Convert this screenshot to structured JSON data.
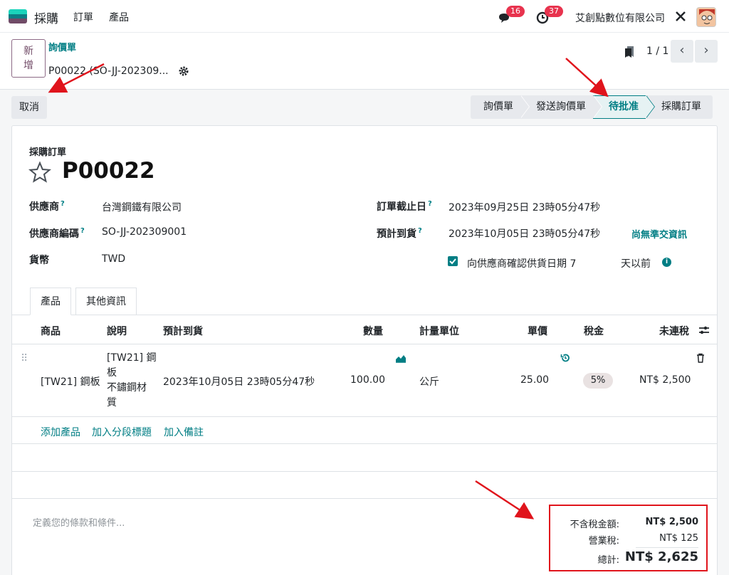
{
  "nav": {
    "app_name": "採購",
    "menu": [
      "訂單",
      "產品"
    ],
    "messages_count": "16",
    "activities_count": "37",
    "company": "艾創點數位有限公司"
  },
  "control": {
    "new_label": "新增",
    "breadcrumb": "詢價單",
    "record_name": "P00022 (SO-JJ-202309...",
    "pager": "1 / 1"
  },
  "actions": {
    "cancel_label": "取消",
    "stages": [
      "詢價單",
      "發送詢價單",
      "待批准",
      "採購訂單"
    ],
    "active_stage": "待批准"
  },
  "form": {
    "doc_type": "採購訂單",
    "title": "P00022",
    "vendor_label": "供應商",
    "vendor": "台灣鋼鐵有限公司",
    "vendor_ref_label": "供應商編碼",
    "vendor_ref": "SO-JJ-202309001",
    "currency_label": "貨幣",
    "currency": "TWD",
    "deadline_label": "訂單截止日",
    "deadline": "2023年09月25日 23時05分47秒",
    "expected_label": "預計到貨",
    "expected": "2023年10月05日 23時05分47秒",
    "on_time_link": "尚無準交資訊",
    "confirm_label": "向供應商確認供貨日期 7",
    "days_before": "天以前",
    "help_mark": "?"
  },
  "tabs": [
    "產品",
    "其他資訊"
  ],
  "table": {
    "headers": [
      "商品",
      "說明",
      "預計到貨",
      "數量",
      "計量單位",
      "單價",
      "稅金",
      "未連稅"
    ],
    "row": {
      "product": "[TW21] 鋼板",
      "desc_lines": [
        "[TW21] 鋼",
        "板",
        "不鏽鋼材",
        "質"
      ],
      "date": "2023年10月05日 23時05分47秒",
      "qty": "100.00",
      "uom": "公斤",
      "price": "25.00",
      "tax": "5%",
      "subtotal": "NT$ 2,500"
    },
    "add_links": [
      "添加產品",
      "加入分段標題",
      "加入備註"
    ]
  },
  "footer": {
    "terms_placeholder": "定義您的條款和條件...",
    "untaxed_label": "不含稅金額:",
    "untaxed": "NT$ 2,500",
    "tax_label": "營業稅:",
    "tax": "NT$ 125",
    "total_label": "總計:",
    "total": "NT$ 2,625"
  },
  "colors": {
    "brand": "#714b67",
    "accent": "#017e84",
    "badge": "#e8334e",
    "highlight": "#e0141c"
  }
}
